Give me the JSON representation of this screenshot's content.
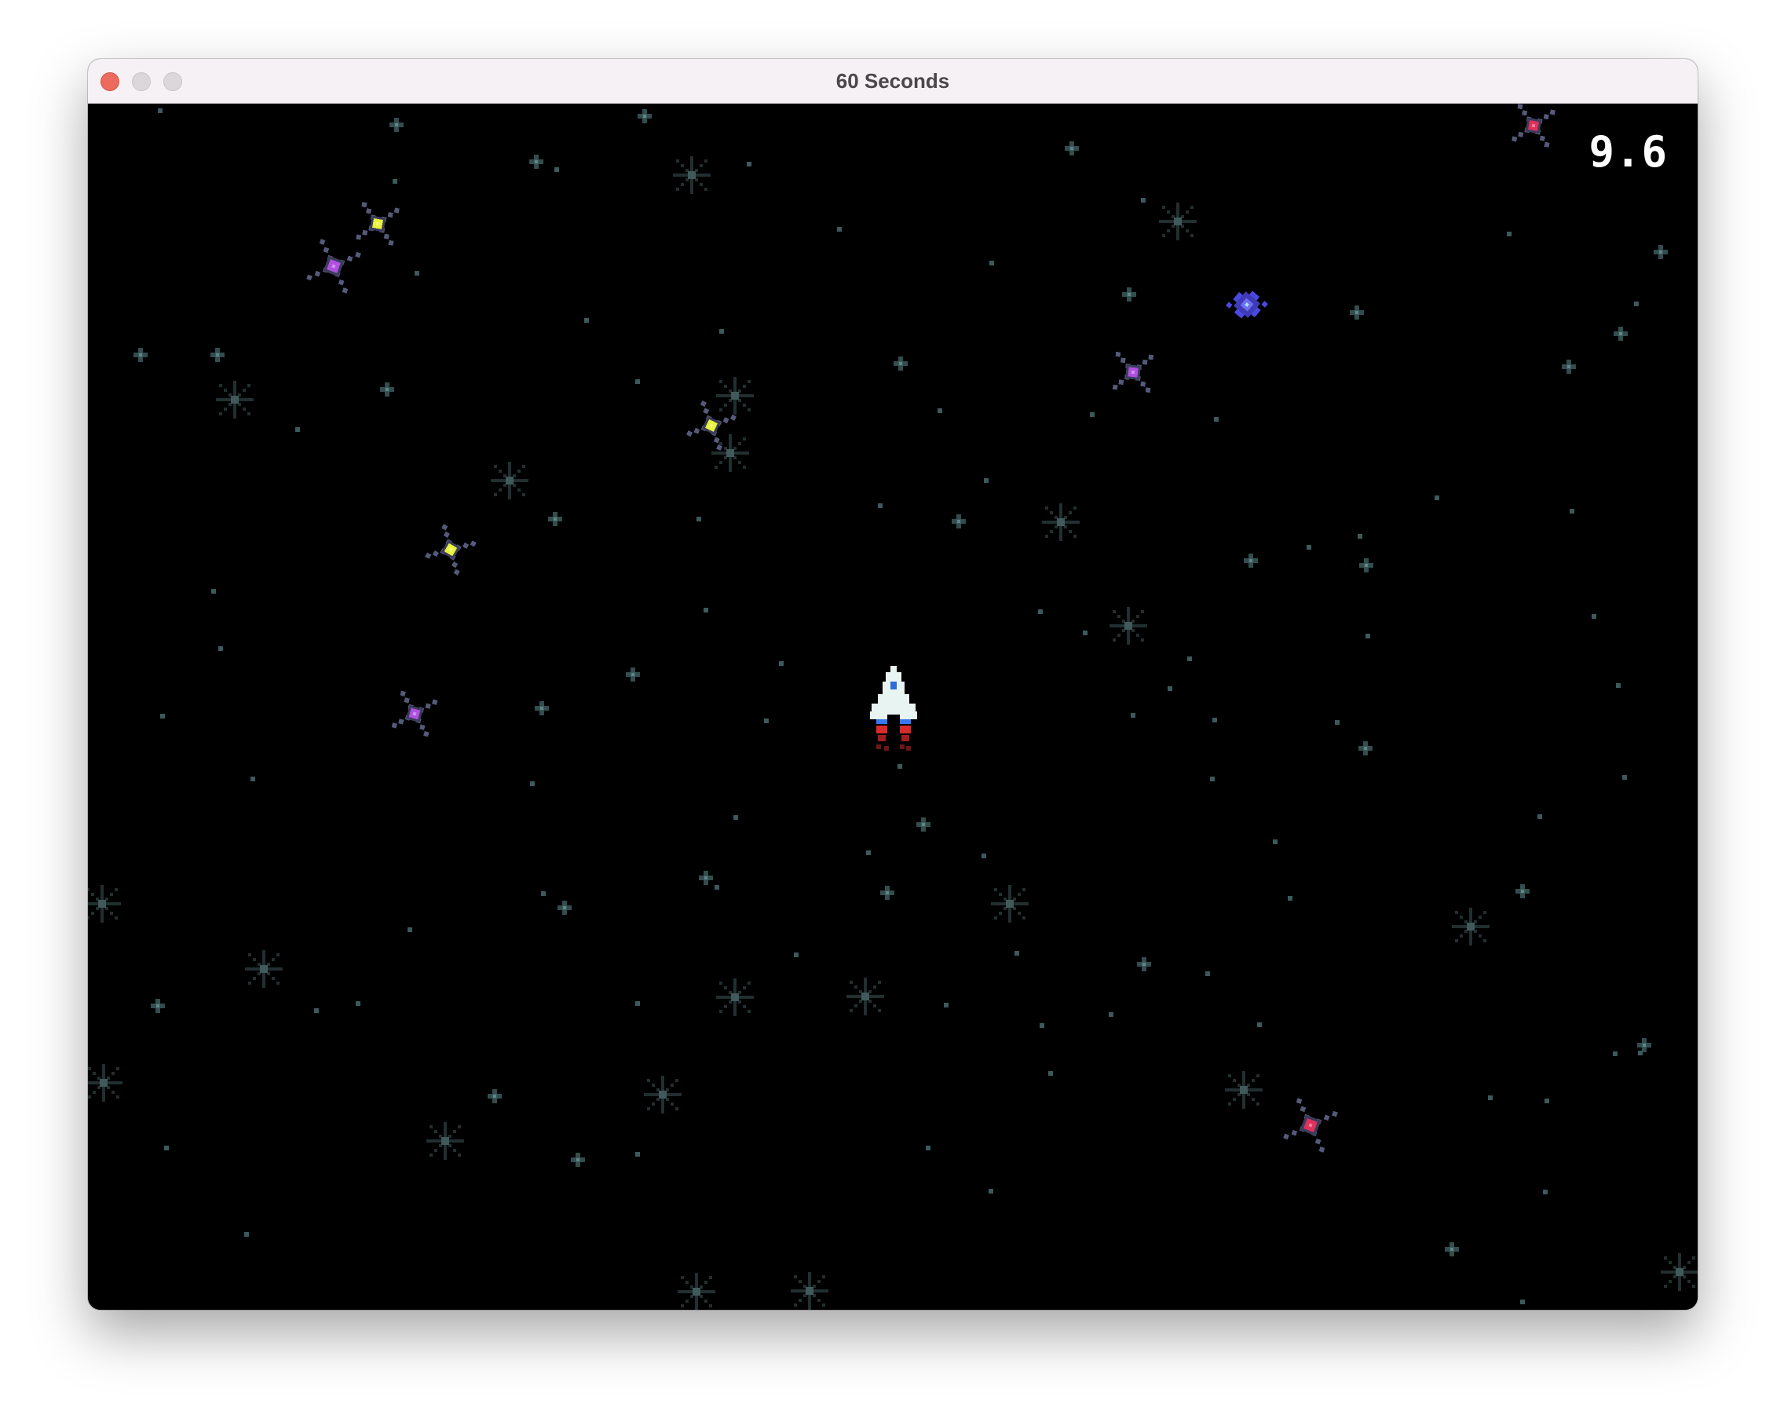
{
  "window": {
    "title": "60 Seconds"
  },
  "hud": {
    "timer": "9.6"
  },
  "colors": {
    "background": "#000000",
    "star": "#3c5a5c",
    "timer_text": "#ffffff",
    "enemy_yellow": "#e8f23a",
    "enemy_purple": "#b04fe0",
    "enemy_red": "#e0305c",
    "enemy_blue": "#4a48e0",
    "ship_body": "#e8f4f2",
    "ship_flame_blue": "#3878f0",
    "ship_flame_red": "#d82a2a"
  },
  "game": {
    "player": "ship-icon",
    "enemies": [
      "yellow-enemy-icon",
      "purple-enemy-icon",
      "red-enemy-icon",
      "blue-enemy-icon"
    ],
    "background": "starfield"
  }
}
